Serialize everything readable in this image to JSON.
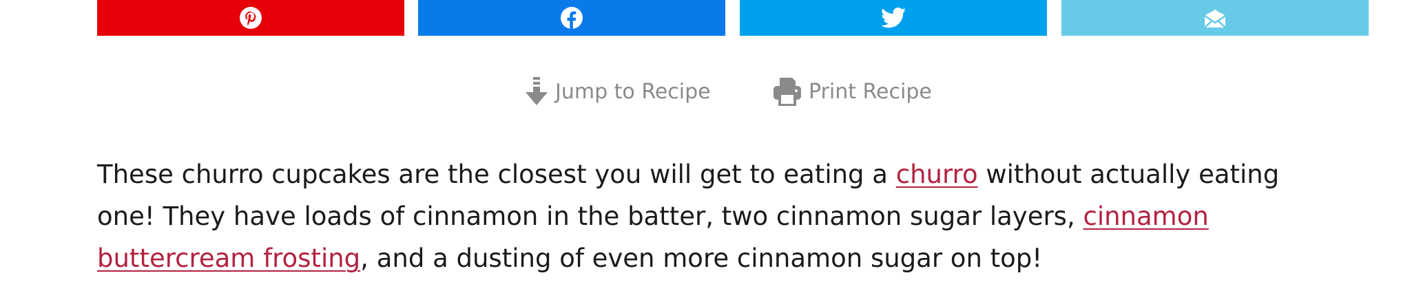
{
  "share": {
    "buttons": [
      {
        "id": "pinterest",
        "icon": "pinterest-icon",
        "color": "#e60008"
      },
      {
        "id": "facebook",
        "icon": "facebook-icon",
        "color": "#0a7aeb"
      },
      {
        "id": "twitter",
        "icon": "twitter-icon",
        "color": "#00a1ec"
      },
      {
        "id": "email",
        "icon": "envelope-open-icon",
        "color": "#67cbe8"
      }
    ]
  },
  "recipe_actions": {
    "jump_label": "Jump to Recipe",
    "jump_icon": "arrow-down-icon",
    "print_label": "Print Recipe",
    "print_icon": "printer-icon",
    "text_color": "#8a8a8a"
  },
  "intro": {
    "part1": "These churro cupcakes are the closest you will get to eating a ",
    "link1": "churro",
    "part2": " without actually eating one! They have loads of cinnamon in the batter, two cinnamon sugar layers, ",
    "link2": "cinnamon buttercream frosting",
    "part3": ", and a dusting of even more cinnamon sugar on top!",
    "link_color": "#b3213f"
  }
}
